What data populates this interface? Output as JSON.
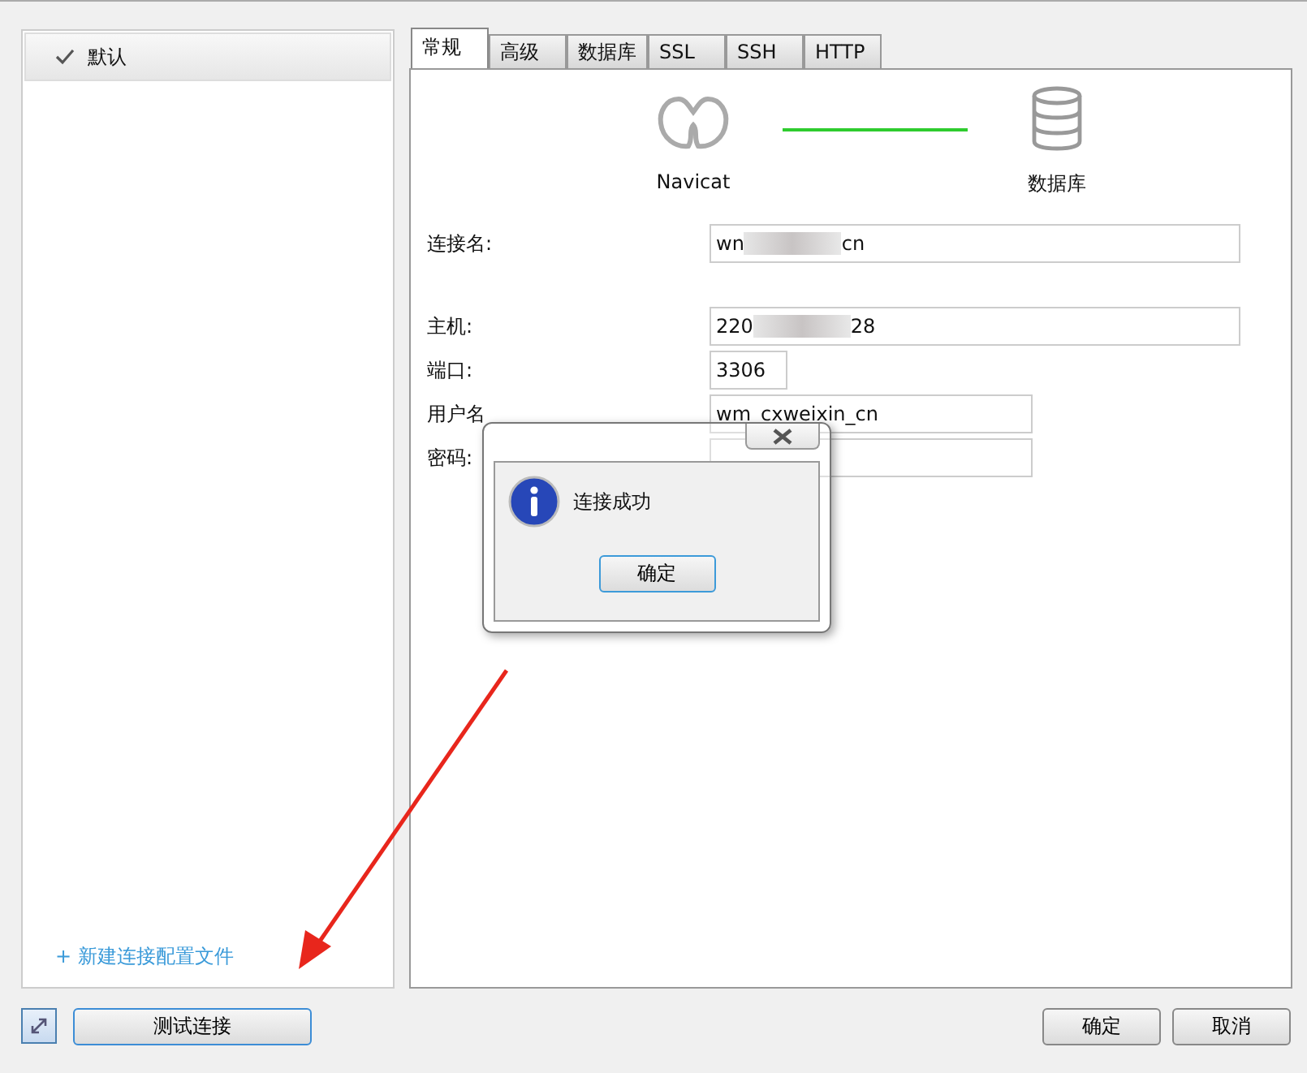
{
  "sidebar": {
    "items": [
      {
        "label": "默认",
        "checked": true
      }
    ],
    "new_profile_link": "+ 新建连接配置文件"
  },
  "tabs": [
    {
      "label": "常规",
      "selected": true
    },
    {
      "label": "高级",
      "selected": false
    },
    {
      "label": "数据库",
      "selected": false
    },
    {
      "label": "SSL",
      "selected": false
    },
    {
      "label": "SSH",
      "selected": false
    },
    {
      "label": "HTTP",
      "selected": false
    }
  ],
  "diagram": {
    "left_label": "Navicat",
    "right_label": "数据库"
  },
  "fields": [
    {
      "label": "连接名:",
      "value_parts": [
        "wn",
        "cn"
      ]
    },
    {
      "label": "主机:",
      "value_parts": [
        "220",
        "28"
      ]
    },
    {
      "label": "端口:",
      "value_parts": [
        "3306"
      ]
    },
    {
      "label": "用户名",
      "value_parts": [
        "wm_cxweixin_cn"
      ]
    },
    {
      "label": "密码:"
    }
  ],
  "dialog": {
    "message": "连接成功",
    "ok": "确定"
  },
  "buttons": {
    "test": "测试连接",
    "ok": "确定",
    "cancel": "取消"
  }
}
